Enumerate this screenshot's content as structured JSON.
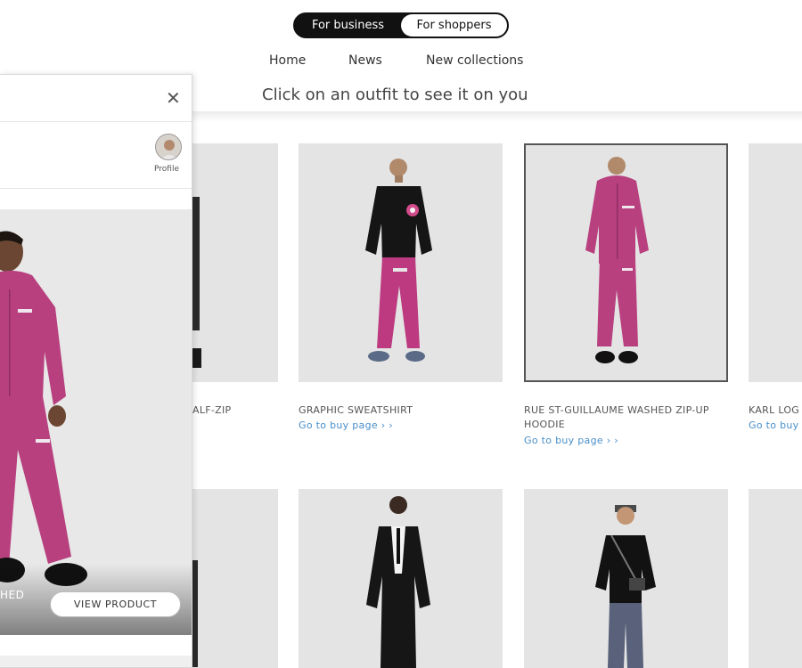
{
  "toggle": {
    "business_label": "For business",
    "shoppers_label": "For shoppers"
  },
  "nav": {
    "home": "Home",
    "news": "News",
    "new_collections": "New collections"
  },
  "subtitle": "Click on an outfit to see it on you",
  "products_row1": [
    {
      "title": "ALF-ZIP",
      "link": ""
    },
    {
      "title": "GRAPHIC SWEATSHIRT",
      "link": "Go to buy page ›  ›"
    },
    {
      "title_line1": "RUE ST-GUILLAUME WASHED ZIP-UP",
      "title_line2": "HOODIE",
      "link": "Go to buy page ›  ›",
      "selected": true
    },
    {
      "title": "KARL LOG",
      "link": "Go to buy"
    }
  ],
  "panel": {
    "avatar_label": "Profile",
    "product_name": "HED",
    "view_product": "VIEW PRODUCT"
  },
  "icons": {
    "close": "close-icon",
    "avatar": "profile-avatar"
  },
  "colors": {
    "accent_pink": "#b8407f",
    "link_blue": "#4a8fc9",
    "card_bg": "#e4e4e4"
  }
}
